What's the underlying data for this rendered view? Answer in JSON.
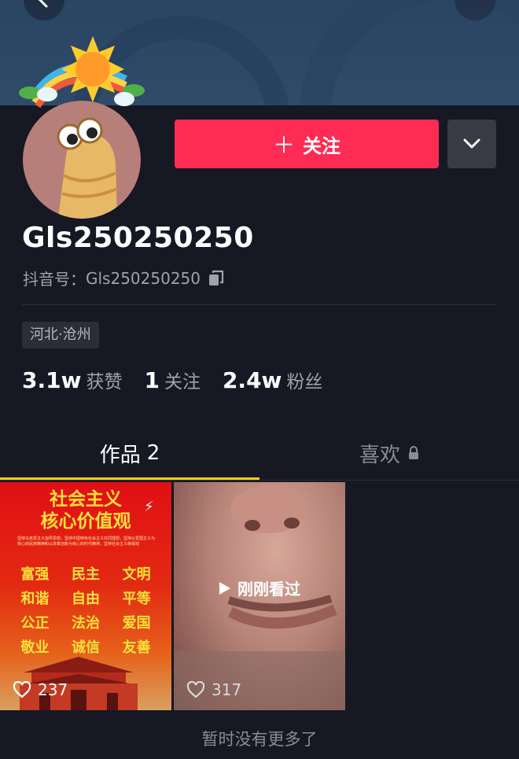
{
  "profile": {
    "follow_label": "关注",
    "username": "Gls250250250",
    "douyin_id_label": "抖音号：",
    "douyin_id": "Gls250250250",
    "location": "河北·沧州"
  },
  "stats": [
    {
      "value": "3.1w",
      "label": "获赞"
    },
    {
      "value": "1",
      "label": "关注"
    },
    {
      "value": "2.4w",
      "label": "粉丝"
    }
  ],
  "tabs": {
    "works_label": "作品",
    "works_count": "2",
    "likes_label": "喜欢"
  },
  "videos": [
    {
      "poster_title_1": "社会主义",
      "poster_title_2": "核心价值观",
      "poster_text": "坚持马克思主义指导思想，坚持中国特色社会主义共同理想，坚持以爱国主义为核心的民族精神和以改革创新为核心的时代精神，坚持社会主义荣辱观",
      "values_rows": [
        [
          "富强",
          "民主",
          "文明"
        ],
        [
          "和谐",
          "自由",
          "平等"
        ],
        [
          "公正",
          "法治",
          "爱国"
        ],
        [
          "敬业",
          "诚信",
          "友善"
        ]
      ],
      "likes": "237"
    },
    {
      "overlay_label": "刚刚看过",
      "likes": "317"
    }
  ],
  "footer": {
    "no_more": "暂时没有更多了"
  },
  "colors": {
    "background": "#161823",
    "follow_button": "#fe2c55",
    "tab_indicator": "#face15"
  }
}
